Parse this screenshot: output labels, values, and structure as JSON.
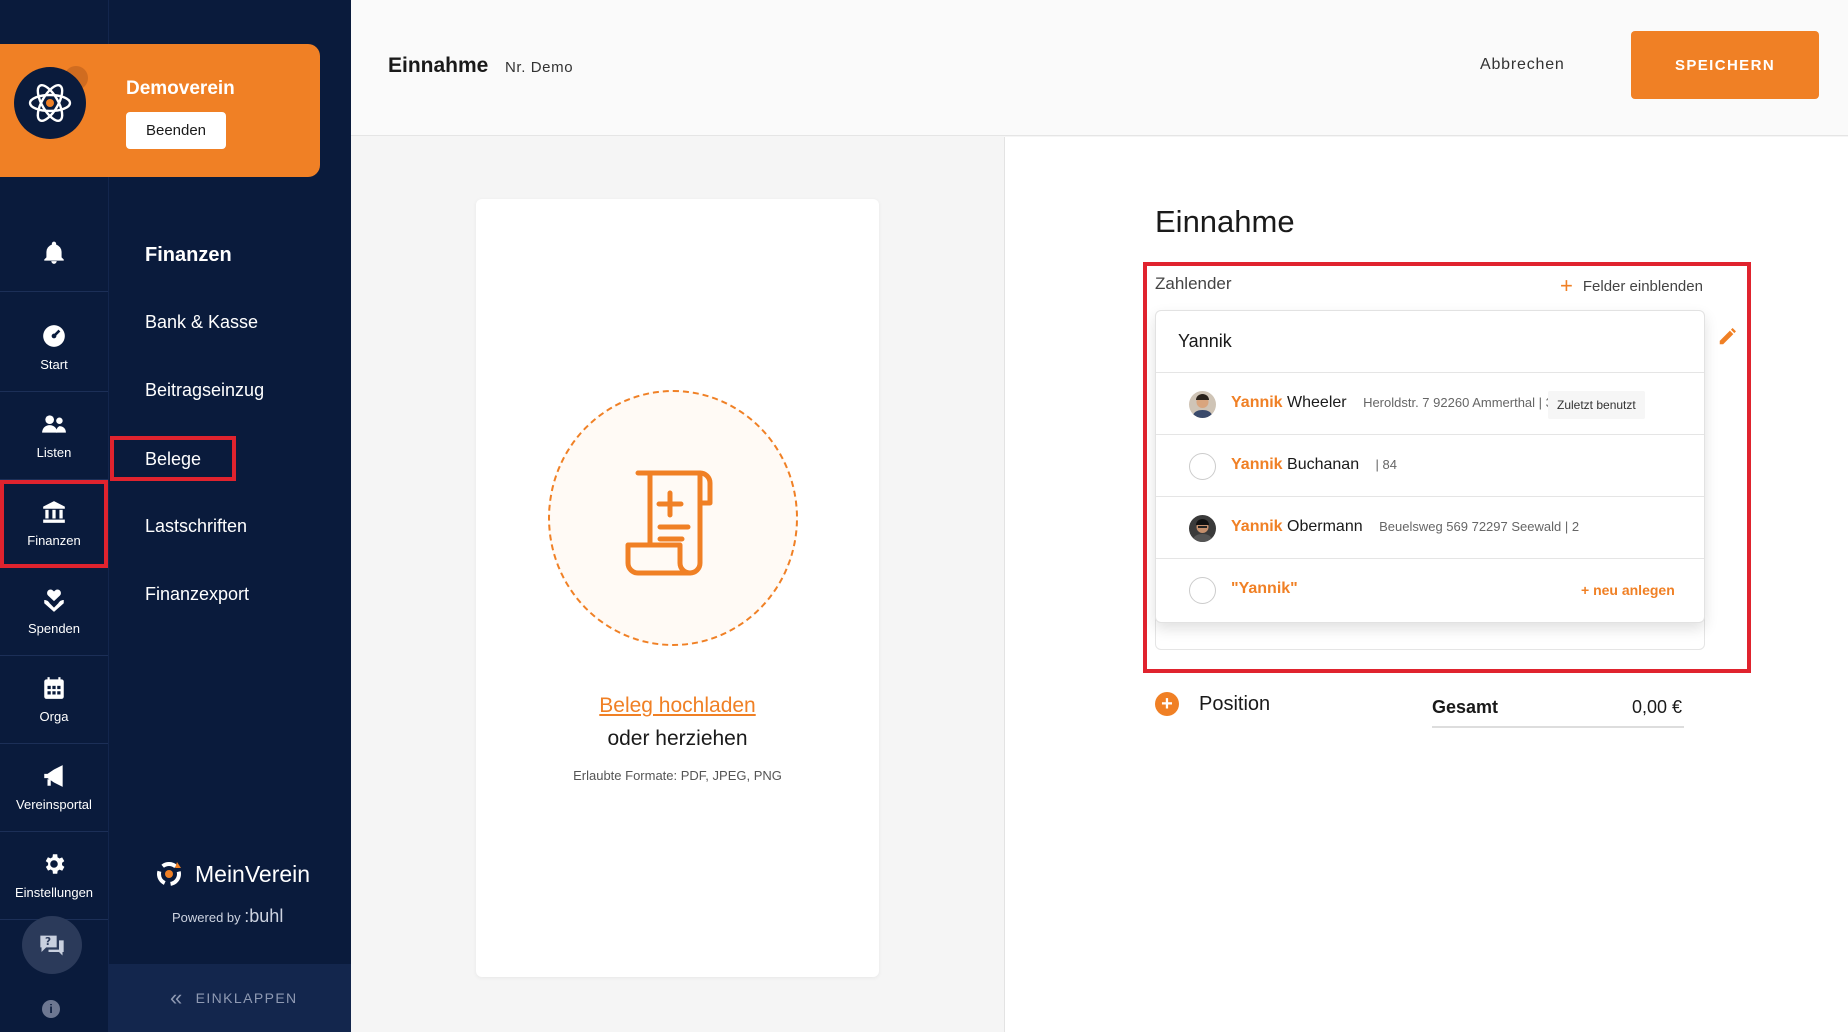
{
  "org": {
    "name": "Demoverein",
    "end_label": "Beenden"
  },
  "rail": {
    "items": [
      {
        "label": "",
        "icon": "bell-icon"
      },
      {
        "label": "Start",
        "icon": "dashboard-icon"
      },
      {
        "label": "Listen",
        "icon": "users-icon"
      },
      {
        "label": "Finanzen",
        "icon": "bank-icon"
      },
      {
        "label": "Spenden",
        "icon": "donation-icon"
      },
      {
        "label": "Orga",
        "icon": "calendar-icon"
      },
      {
        "label": "Vereinsportal",
        "icon": "megaphone-icon"
      },
      {
        "label": "Einstellungen",
        "icon": "gear-icon"
      }
    ],
    "selected": "Finanzen"
  },
  "panel": {
    "title": "Finanzen",
    "links": [
      "Bank & Kasse",
      "Beitragseinzug",
      "Belege",
      "Lastschriften",
      "Finanzexport"
    ],
    "selected": "Belege",
    "brand": "MeinVerein",
    "powered": "Powered by",
    "powered_brand": ":buhl",
    "collapse": "EINKLAPPEN"
  },
  "header": {
    "title": "Einnahme",
    "nr": "Nr. Demo",
    "cancel": "Abbrechen",
    "save": "SPEICHERN"
  },
  "upload": {
    "link": "Beleg hochladen",
    "or": "oder herziehen",
    "formats": "Erlaubte Formate: PDF, JPEG, PNG"
  },
  "form": {
    "title": "Einnahme",
    "payer_label": "Zahlender",
    "show_fields": "Felder einblenden",
    "search_value": "Yannik",
    "options": [
      {
        "first": "Yannik",
        "last": "Wheeler",
        "meta": "Heroldstr. 7 92260 Ammerthal | 33",
        "badge": "Zuletzt benutzt",
        "avatar": "photo"
      },
      {
        "first": "Yannik",
        "last": "Buchanan",
        "meta": "| 84",
        "badge": "",
        "avatar": "empty"
      },
      {
        "first": "Yannik",
        "last": "Obermann",
        "meta": "Beuelsweg 569 72297 Seewald | 2",
        "badge": "",
        "avatar": "photo2"
      }
    ],
    "new_option": {
      "label": "\"Yannik\"",
      "action": "+ neu anlegen"
    },
    "position_label": "Position",
    "total_label": "Gesamt",
    "total_value": "0,00 €"
  },
  "colors": {
    "accent": "#f08025",
    "nav_bg": "#0a1b3c",
    "highlight": "#e0232e"
  }
}
